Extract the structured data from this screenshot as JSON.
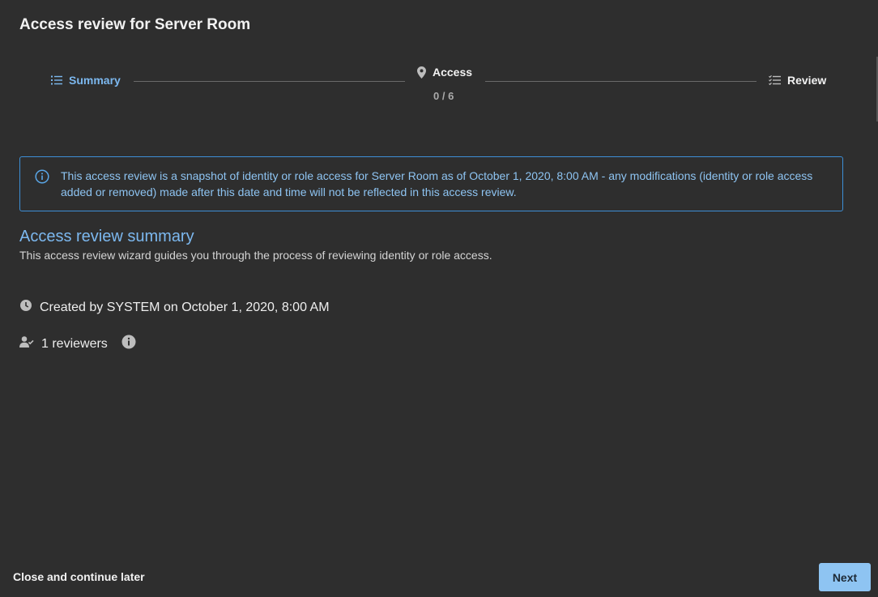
{
  "dialog": {
    "title": "Access review for Server Room"
  },
  "stepper": {
    "steps": [
      {
        "label": "Summary",
        "icon": "list-icon",
        "active": true
      },
      {
        "label": "Access",
        "icon": "location-pin-icon",
        "count": "0 / 6"
      },
      {
        "label": "Review",
        "icon": "checklist-icon"
      }
    ]
  },
  "info_banner": {
    "icon": "info-icon",
    "text": "This access review is a snapshot of identity or role access for Server Room as of October 1, 2020, 8:00 AM - any modifications (identity or role access added or removed) made after this date and time will not be reflected in this access review."
  },
  "summary": {
    "title": "Access review summary",
    "subtitle": "This access review wizard guides you through the process of reviewing identity or role access.",
    "created": "Created by SYSTEM on October 1, 2020, 8:00 AM",
    "reviewers": "1 reviewers"
  },
  "footer": {
    "close_label": "Close and continue later",
    "next_label": "Next"
  },
  "colors": {
    "background": "#2e2e2e",
    "accent": "#7cb8ef",
    "banner_border": "#3d8fd6",
    "button_bg": "#8ec4f2"
  }
}
